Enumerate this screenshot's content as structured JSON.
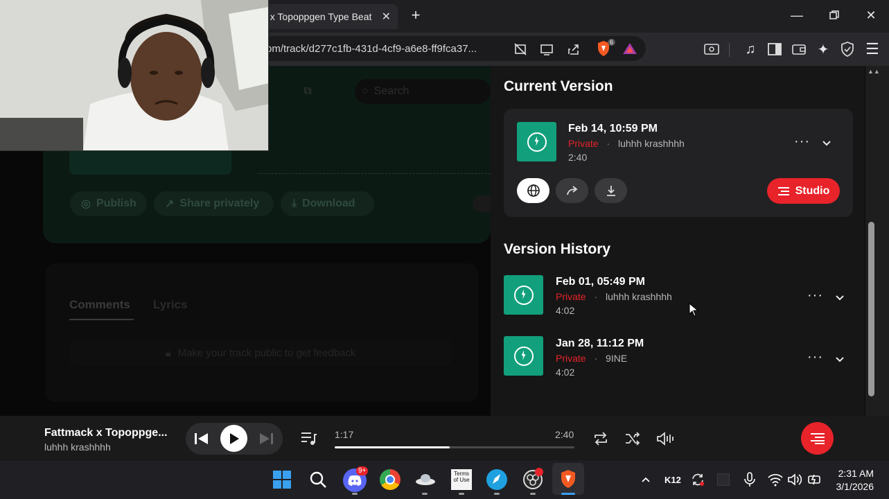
{
  "browser": {
    "tab_title": "t x Topoppgen Type Beat",
    "url": "om/track/d277c1fb-431d-4cf9-a6e8-ff9fca37...",
    "brave_badge": "6"
  },
  "page": {
    "search_placeholder": "Search",
    "buttons": [
      "Publish",
      "Share privately",
      "Download"
    ],
    "tabs": [
      "Comments",
      "Lyrics"
    ],
    "comments_notice": "Make your track public to get feedback"
  },
  "current_version": {
    "title": "Current Version",
    "date": "Feb 14, 10:59 PM",
    "privacy": "Private",
    "separator": "·",
    "artist": "luhhh krashhhh",
    "duration": "2:40",
    "studio_label": "Studio"
  },
  "version_history": {
    "title": "Version History",
    "items": [
      {
        "date": "Feb 01, 05:49 PM",
        "privacy": "Private",
        "artist": "luhhh krashhhh",
        "duration": "4:02"
      },
      {
        "date": "Jan 28, 11:12 PM",
        "privacy": "Private",
        "artist": "9INE",
        "duration": "4:02"
      }
    ]
  },
  "player": {
    "track_title": "Fattmack x Topoppge...",
    "artist": "luhhh krashhhh",
    "elapsed": "1:17",
    "total": "2:40",
    "progress": 0.48
  },
  "taskbar": {
    "discord_badge": "9+",
    "terms_icon_text": "Terms of Use",
    "k12_label": "K12",
    "time": "2:31 AM",
    "date": "3/1/2026"
  },
  "colors": {
    "accent_red": "#e8232a",
    "thumb_green": "#12a07c"
  }
}
